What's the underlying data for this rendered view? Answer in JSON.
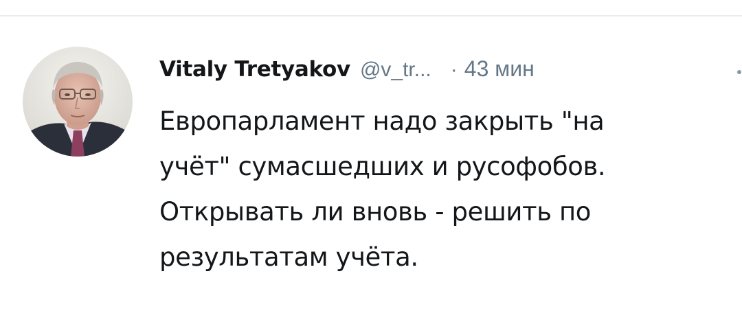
{
  "tweet": {
    "author": {
      "display_name": "Vitaly Tretyakov",
      "handle": "@v_tr...",
      "avatar_icon": "user-avatar-photo"
    },
    "separator": "·",
    "timestamp": "43 мин",
    "text_lines": [
      "Европарламент надо закрыть \"на",
      "учёт\" сумасшедших и русофобов.",
      "Открывать ли вновь - решить по",
      "результатам учёта."
    ],
    "menu_icon": "caret-down-icon"
  },
  "colors": {
    "text_primary": "#14171a",
    "text_secondary": "#657786",
    "divider": "#e6ecf0",
    "background": "#ffffff"
  }
}
